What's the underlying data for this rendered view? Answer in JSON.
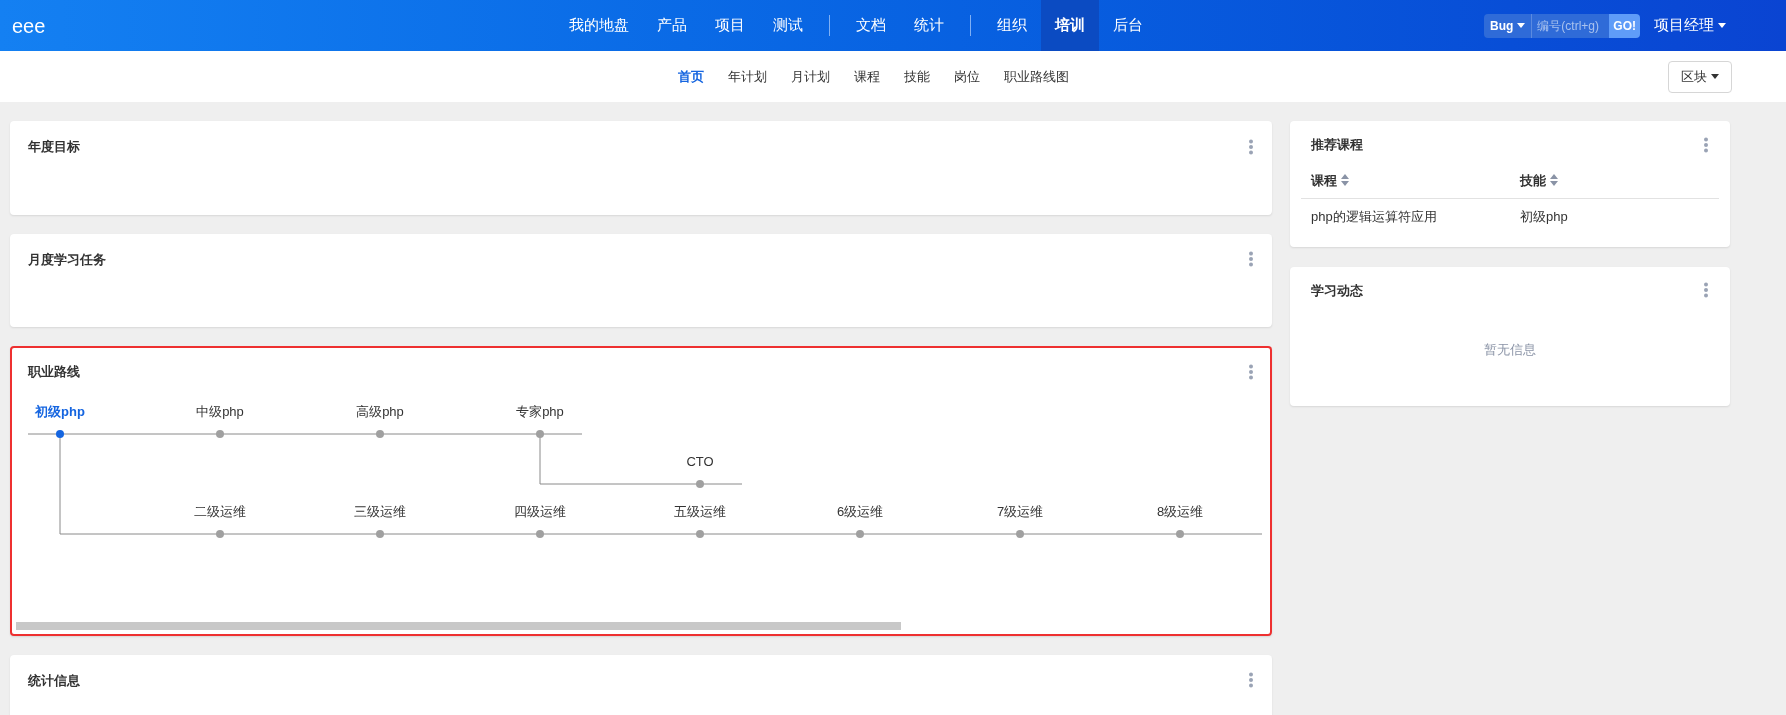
{
  "header": {
    "logo": "eee",
    "nav_groups": [
      [
        {
          "label": "我的地盘",
          "selected": false
        },
        {
          "label": "产品",
          "selected": false
        },
        {
          "label": "项目",
          "selected": false
        },
        {
          "label": "测试",
          "selected": false
        }
      ],
      [
        {
          "label": "文档",
          "selected": false
        },
        {
          "label": "统计",
          "selected": false
        }
      ],
      [
        {
          "label": "组织",
          "selected": false
        },
        {
          "label": "培训",
          "selected": true
        },
        {
          "label": "后台",
          "selected": false
        }
      ]
    ],
    "search": {
      "type": "Bug",
      "placeholder": "编号(ctrl+g)",
      "go": "GO!"
    },
    "user": "项目经理"
  },
  "subnav": {
    "items": [
      {
        "label": "首页",
        "selected": true
      },
      {
        "label": "年计划",
        "selected": false
      },
      {
        "label": "月计划",
        "selected": false
      },
      {
        "label": "课程",
        "selected": false
      },
      {
        "label": "技能",
        "selected": false
      },
      {
        "label": "岗位",
        "selected": false
      },
      {
        "label": "职业路线图",
        "selected": false
      }
    ],
    "block_button": "区块"
  },
  "left_cards": [
    {
      "kind": "empty",
      "title": "年度目标",
      "highlighted": false
    },
    {
      "kind": "empty",
      "title": "月度学习任务",
      "highlighted": false
    },
    {
      "kind": "career",
      "title": "职业路线",
      "highlighted": true,
      "career_path": {
        "label": "初级php",
        "selected": true,
        "next": {
          "label": "中级php",
          "selected": false,
          "next": {
            "label": "高级php",
            "selected": false,
            "next": {
              "label": "专家php",
              "selected": false,
              "branches": [
                {
                  "label": "CTO",
                  "selected": false
                }
              ]
            }
          }
        },
        "branches": [
          {
            "label": "二级运维",
            "selected": false,
            "next": {
              "label": "三级运维",
              "selected": false,
              "next": {
                "label": "四级运维",
                "selected": false,
                "next": {
                  "label": "五级运维",
                  "selected": false,
                  "next": {
                    "label": "6级运维",
                    "selected": false,
                    "next": {
                      "label": "7级运维",
                      "selected": false,
                      "next": {
                        "label": "8级运维",
                        "selected": false
                      }
                    }
                  }
                }
              }
            }
          }
        ]
      }
    },
    {
      "kind": "empty",
      "title": "统计信息",
      "highlighted": false
    }
  ],
  "right_cards": [
    {
      "kind": "table",
      "title": "推荐课程",
      "columns": [
        "课程",
        "技能"
      ],
      "rows": [
        [
          "php的逻辑运算符应用",
          "初级php"
        ]
      ]
    },
    {
      "kind": "message",
      "title": "学习动态",
      "message": "暂无信息"
    }
  ]
}
